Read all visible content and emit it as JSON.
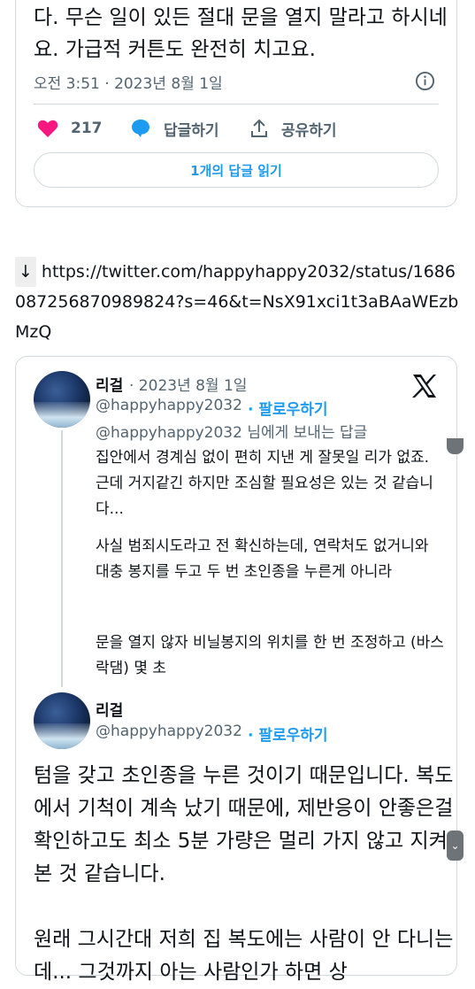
{
  "tweet1": {
    "text": "다. 무슨 일이 있든 절대 문을 열지 말라고 하시네요. 가급적 커튼도 완전히 치고요.",
    "meta": "오전 3:51 · 2023년 8월 1일",
    "likes": "217",
    "reply_label": "답글하기",
    "share_label": "공유하기",
    "read_replies_label": "1개의 답글 읽기"
  },
  "link": {
    "arrow": "↓",
    "url": "https://twitter.com/happyhappy2032/status/1686087256870989824?s=46&t=NsX91xci1t3aBAaWEzbMzQ"
  },
  "tweet2": {
    "name": "리걸",
    "date": "· 2023년 8월 1일",
    "handle": "@happyhappy2032",
    "follow": "· 팔로우하기",
    "reply_to": "@happyhappy2032 님에게 보내는 답글",
    "para1": "집안에서 경계심 없이 편히 지낸 게 잘못일 리가 없죠. 근데 거지같긴 하지만 조심할 필요성은 있는 것 같습니다...",
    "para2": "사실 범죄시도라고 전 확신하는데, 연락처도 없거니와 대충 봉지를 두고 두 번 초인종을 누른게 아니라",
    "para3": "문을 열지 않자 비닐봉지의 위치를 한 번 조정하고 (바스락댐) 몇 초"
  },
  "tweet3": {
    "name": "리걸",
    "handle": "@happyhappy2032",
    "follow": "· 팔로우하기",
    "para1": "텀을 갖고 초인종을 누른 것이기 때문입니다. 복도에서 기척이 계속 났기 때문에, 제반응이 안좋은걸 확인하고도 최소 5분 가량은 멀리 가지 않고 지켜본 것 같습니다.",
    "para2": "원래 그시간대 저희 집 복도에는 사람이 안 다니는데... 그것까지 아는 사람인가 하면 상"
  },
  "colors": {
    "accent": "#1d9bf0",
    "heart": "#f91880",
    "muted": "#536471",
    "border": "#cfd9de"
  }
}
